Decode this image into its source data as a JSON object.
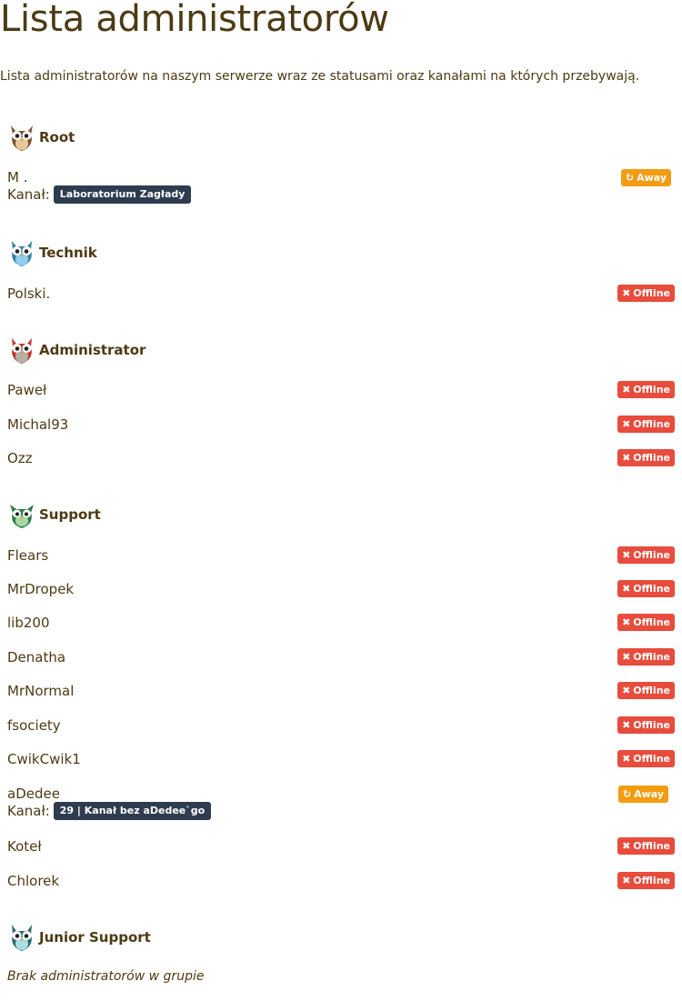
{
  "page": {
    "title": "Lista administratorów",
    "description": "Lista administratorów na naszym serwerze wraz ze statusami oraz kanałami na których przebywają."
  },
  "labels": {
    "channel_prefix": "Kanał:",
    "offline": "Offline",
    "away": "Away"
  },
  "colors": {
    "offline": "#e74c3c",
    "away": "#f39c12",
    "channel_badge": "#2e3c4f",
    "text": "#4d3a13"
  },
  "groups": [
    {
      "name": "Root",
      "icon": "owl-brown-icon",
      "members": [
        {
          "name": "M .",
          "status": "Away",
          "channel": "Laboratorium Zagłady"
        }
      ]
    },
    {
      "name": "Technik",
      "icon": "owl-blue-icon",
      "members": [
        {
          "name": "Polski.",
          "status": "Offline"
        }
      ]
    },
    {
      "name": "Administrator",
      "icon": "owl-red-icon",
      "members": [
        {
          "name": "Paweł",
          "status": "Offline"
        },
        {
          "name": "Michal93",
          "status": "Offline"
        },
        {
          "name": "Ozz",
          "status": "Offline"
        }
      ]
    },
    {
      "name": "Support",
      "icon": "owl-green-icon",
      "members": [
        {
          "name": "Flears",
          "status": "Offline"
        },
        {
          "name": "MrDropek",
          "status": "Offline"
        },
        {
          "name": "lib200",
          "status": "Offline"
        },
        {
          "name": "Denatha",
          "status": "Offline"
        },
        {
          "name": "MrNormal",
          "status": "Offline"
        },
        {
          "name": "fsociety",
          "status": "Offline"
        },
        {
          "name": "CwikCwik1",
          "status": "Offline"
        },
        {
          "name": "aDedee",
          "status": "Away",
          "channel": "29 | Kanał bez aDedee`go"
        },
        {
          "name": "Koteł",
          "status": "Offline"
        },
        {
          "name": "Chlorek",
          "status": "Offline"
        }
      ]
    },
    {
      "name": "Junior Support",
      "icon": "owl-teal-icon",
      "members": [],
      "empty_text": "Brak administratorów w grupie"
    }
  ]
}
